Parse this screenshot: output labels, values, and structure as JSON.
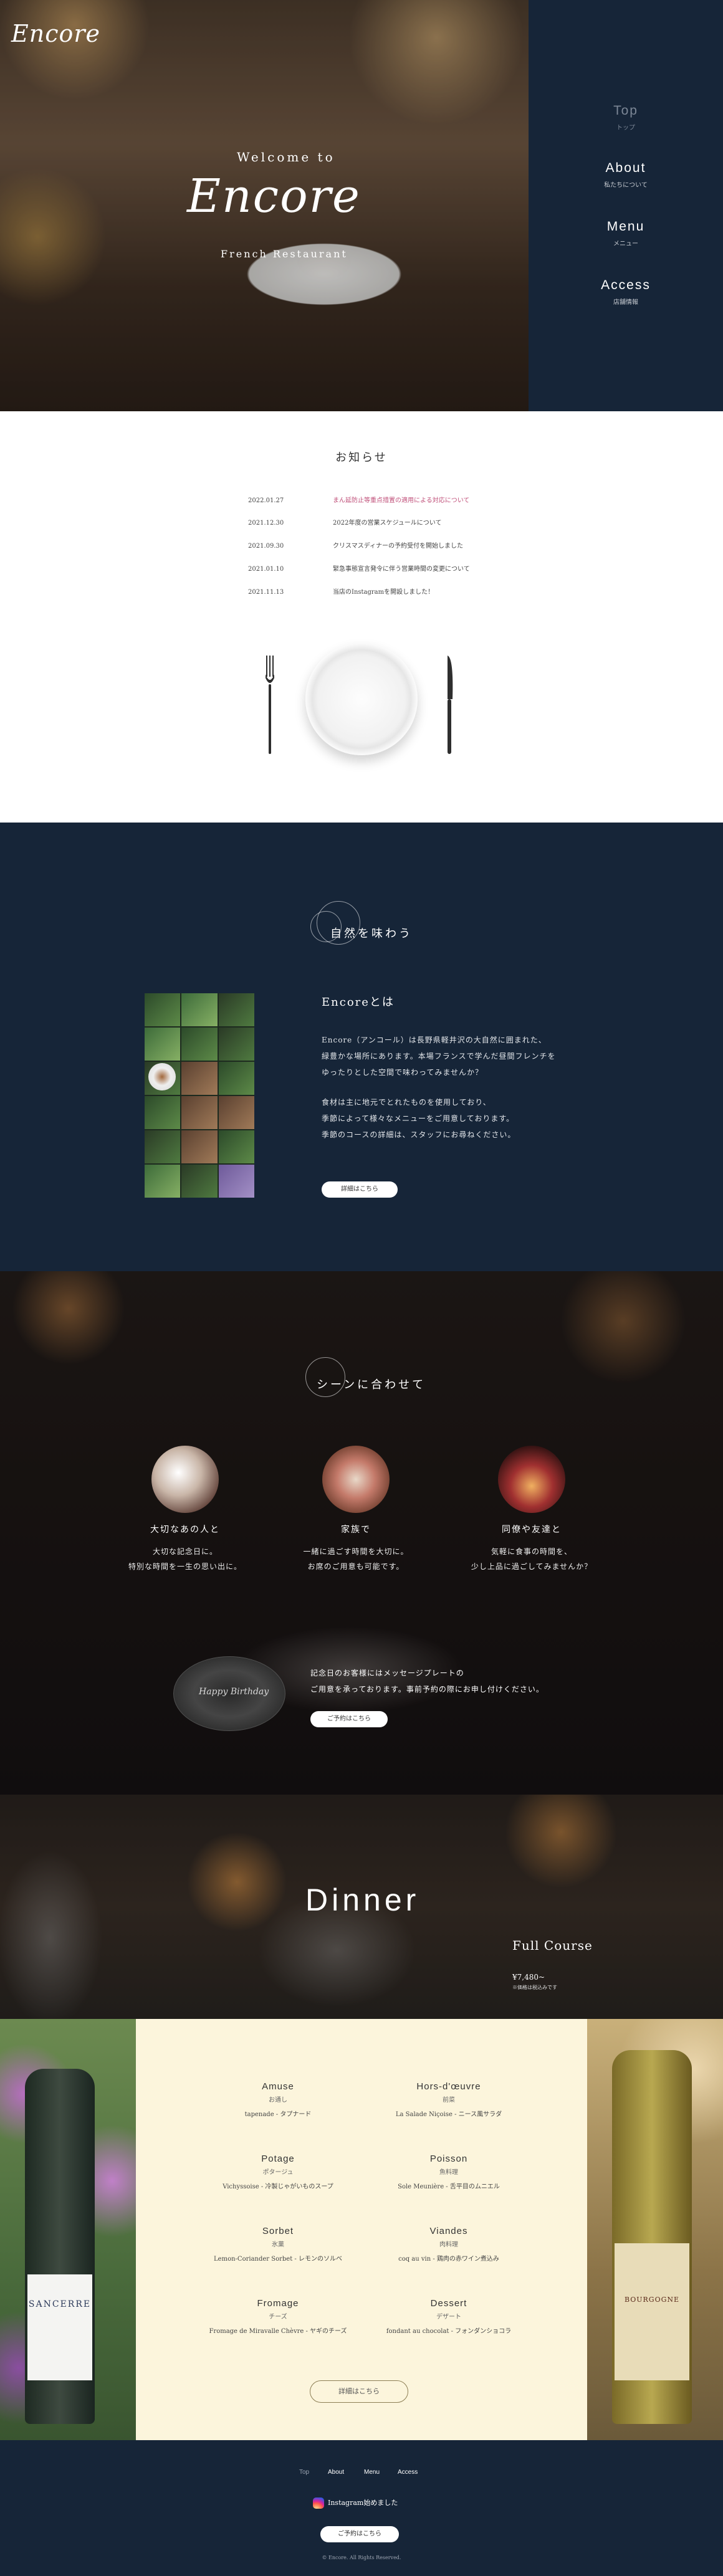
{
  "hero": {
    "logo": "Encore",
    "welcome": "Welcome to",
    "title": "Encore",
    "tagline": "French Restaurant",
    "nav": [
      {
        "en": "Top",
        "jp": "トップ"
      },
      {
        "en": "About",
        "jp": "私たちについて"
      },
      {
        "en": "Menu",
        "jp": "メニュー"
      },
      {
        "en": "Access",
        "jp": "店舗情報"
      }
    ]
  },
  "news": {
    "heading": "お知らせ",
    "items": [
      {
        "date": "2022.01.27",
        "text": "まん延防止等重点措置の適用による対応について"
      },
      {
        "date": "2021.12.30",
        "text": "2022年度の営業スケジュールについて"
      },
      {
        "date": "2021.09.30",
        "text": "クリスマスディナーの予約受付を開始しました"
      },
      {
        "date": "2021.01.10",
        "text": "緊急事態宣言発令に伴う営業時間の変更について"
      },
      {
        "date": "2021.11.13",
        "text": "当店のInstagramを開設しました！"
      }
    ]
  },
  "about": {
    "title": "自然を味わう",
    "heading": "Encoreとは",
    "p1": [
      "Encore（アンコール）は長野県軽井沢の大自然に囲まれた、",
      "緑豊かな場所にあります。本場フランスで学んだ昼間フレンチを",
      "ゆったりとした空間で味わってみませんか？"
    ],
    "p2": [
      "食材は主に地元でとれたものを使用しており、",
      "季節によって様々なメニューをご用意しております。",
      "季節のコースの詳細は、スタッフにお尋ねください。"
    ],
    "button": "詳細はこちら"
  },
  "scene": {
    "title": "シーンに合わせて",
    "cols": [
      {
        "title": "大切なあの人と",
        "lines": [
          "大切な記念日に。",
          "特別な時間を一生の思い出に。"
        ]
      },
      {
        "title": "家族で",
        "lines": [
          "一緒に過ごす時間を大切に。",
          "お席のご用意も可能です。"
        ]
      },
      {
        "title": "同僚や友達と",
        "lines": [
          "気軽に食事の時間を、",
          "少し上品に過ごしてみませんか？"
        ]
      }
    ],
    "plate_text": "Happy Birthday",
    "notice": [
      "記念日のお客様にはメッセージプレートの",
      "ご用意を承っております。事前予約の際にお申し付けください。"
    ],
    "button": "ご予約はこちら"
  },
  "dinner": {
    "title": "Dinner",
    "course": "Full Course",
    "price": "¥7,480~",
    "note": "※価格は税込みです"
  },
  "menu": {
    "courses": [
      {
        "en": "Amuse",
        "jp": "お通し",
        "desc": "tapenade - タプナード"
      },
      {
        "en": "Hors-d'œuvre",
        "jp": "前菜",
        "desc": "La Salade Niçoise - ニース風サラダ"
      },
      {
        "en": "Potage",
        "jp": "ポタージュ",
        "desc": "Vichyssoise - 冷製じゃがいものスープ"
      },
      {
        "en": "Poisson",
        "jp": "魚料理",
        "desc": "Sole Meunière - 舌平目のムニエル"
      },
      {
        "en": "Sorbet",
        "jp": "氷菓",
        "desc": "Lemon-Coriander Sorbet - レモンのソルベ"
      },
      {
        "en": "Viandes",
        "jp": "肉料理",
        "desc": "coq au vin - 鶏肉の赤ワイン煮込み"
      },
      {
        "en": "Fromage",
        "jp": "チーズ",
        "desc": "Fromage de Miravalle Chèvre - ヤギのチーズ"
      },
      {
        "en": "Dessert",
        "jp": "デザート",
        "desc": "fondant au chocolat - フォンダンショコラ"
      }
    ],
    "button": "詳細はこちら",
    "wine_left": "SANCERRE",
    "wine_right": "BOURGOGNE"
  },
  "footer": {
    "nav": [
      "Top",
      "About",
      "Menu",
      "Access"
    ],
    "instagram": "Instagram始めました",
    "button": "ご予約はこちら",
    "copyright": "© Encore. All Rights Reserved."
  },
  "colors": {
    "navy": "#162538",
    "cream": "#fcf5dc",
    "accent_pink": "#c0507a"
  }
}
